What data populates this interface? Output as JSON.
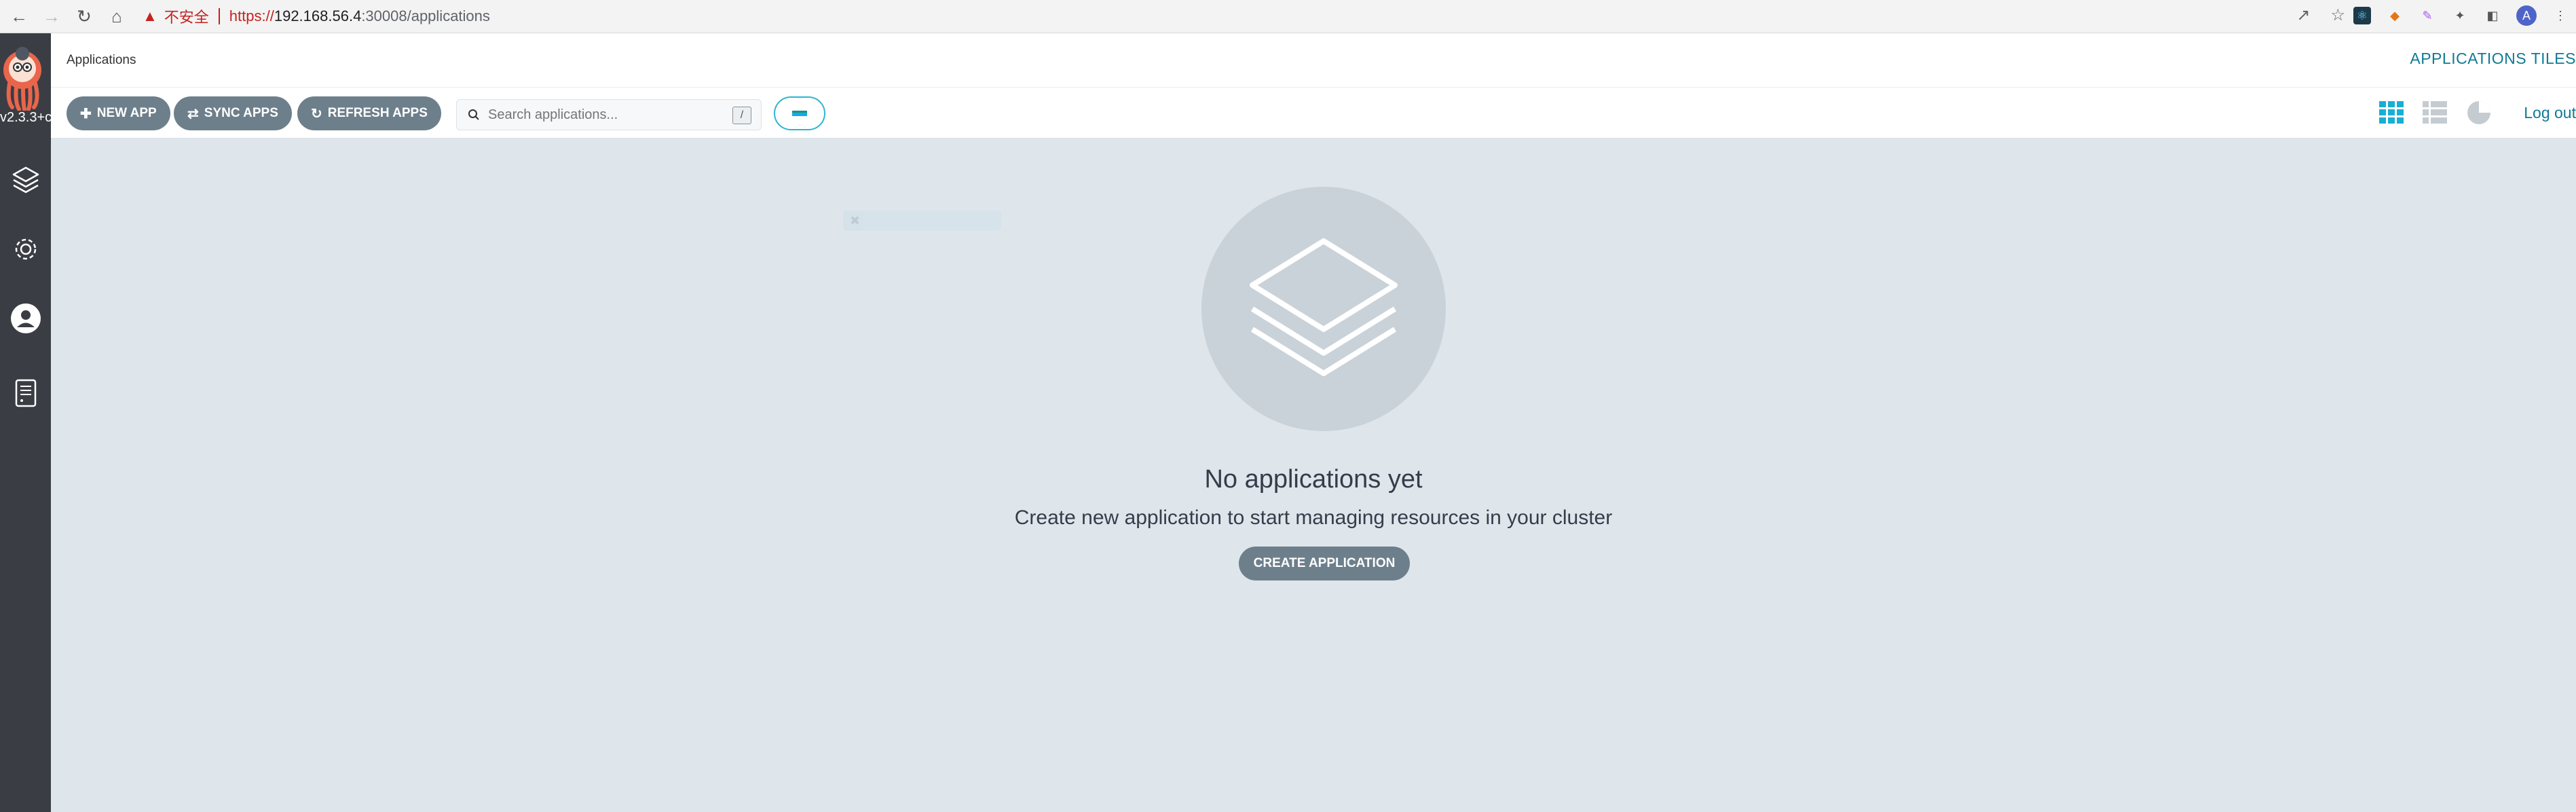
{
  "browser": {
    "back_icon": "arrow-left-icon",
    "forward_icon": "arrow-right-icon",
    "reload_icon": "reload-icon",
    "home_icon": "home-icon",
    "security_label": "不安全",
    "url_scheme": "https://",
    "url_host": "192.168.56.4",
    "url_path": ":30008/applications",
    "profile_initial": "A"
  },
  "sidebar": {
    "version": "v2.3.3+c",
    "items": [
      {
        "icon": "layers-icon"
      },
      {
        "icon": "gear-icon"
      },
      {
        "icon": "user-icon"
      },
      {
        "icon": "docs-icon"
      }
    ]
  },
  "header": {
    "breadcrumb": "Applications",
    "title": "APPLICATIONS TILES"
  },
  "toolbar": {
    "new_app": "NEW APP",
    "sync_apps": "SYNC APPS",
    "refresh_apps": "REFRESH APPS",
    "search_placeholder": "Search applications...",
    "search_shortcut": "/",
    "logout": "Log out"
  },
  "empty_state": {
    "title": "No applications yet",
    "subtitle": "Create new application to start managing resources in your cluster",
    "button": "CREATE APPLICATION"
  },
  "colors": {
    "accent": "#0f7a93",
    "button": "#6d7f8b",
    "sidebar": "#3a3e44",
    "background": "#dee6eb"
  }
}
